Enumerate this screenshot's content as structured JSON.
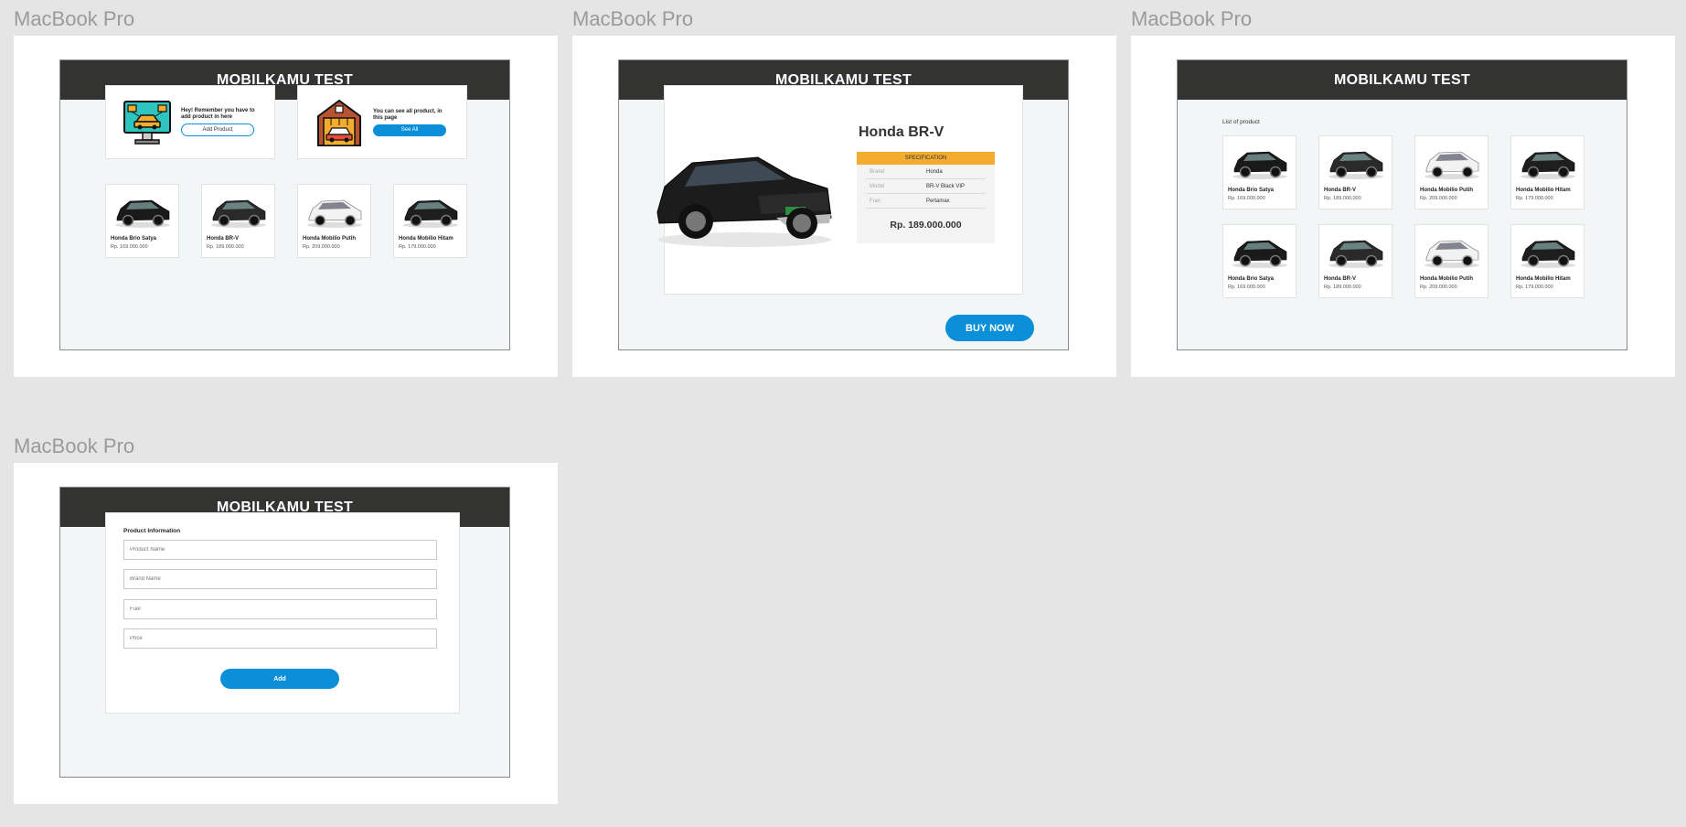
{
  "frames": {
    "label": "MacBook Pro",
    "app_title": "MOBILKAMU TEST"
  },
  "home": {
    "promo_add": {
      "text": "Hey! Remember you have to add product in here",
      "button": "Add Product"
    },
    "promo_see": {
      "text": "You can see all product, in this page",
      "button": "See All"
    }
  },
  "products": [
    {
      "name": "Honda Brio Satya",
      "price": "Rp. 169.000.000",
      "color": "#1a1a1a"
    },
    {
      "name": "Honda BR-V",
      "price": "Rp. 189.000.000",
      "color": "#2a2a2a"
    },
    {
      "name": "Honda Mobilio Putih",
      "price": "Rp. 209.000.000",
      "color": "#f2f2f2"
    },
    {
      "name": "Honda Mobilio Hitam",
      "price": "Rp. 179.000.000",
      "color": "#1e1e1e"
    }
  ],
  "detail": {
    "name": "Honda BR-V",
    "spec_header": "SPECIFICATION",
    "specs": [
      {
        "label": "Brand",
        "value": "Honda"
      },
      {
        "label": "Model",
        "value": "BR-V Black VIP"
      },
      {
        "label": "Fuel",
        "value": "Pertamax"
      }
    ],
    "price": "Rp. 189.000.000",
    "buy_label": "BUY NOW"
  },
  "list": {
    "title": "List of product"
  },
  "form": {
    "title": "Product Information",
    "fields": [
      "Product Name",
      "Brand Name",
      "Fuel",
      "Price"
    ],
    "submit": "Add"
  },
  "colors": {
    "header_bg": "#333432",
    "accent_blue": "#0a8fd8",
    "spec_orange": "#f2ac2f",
    "canvas_bg": "#e5e5e5"
  }
}
